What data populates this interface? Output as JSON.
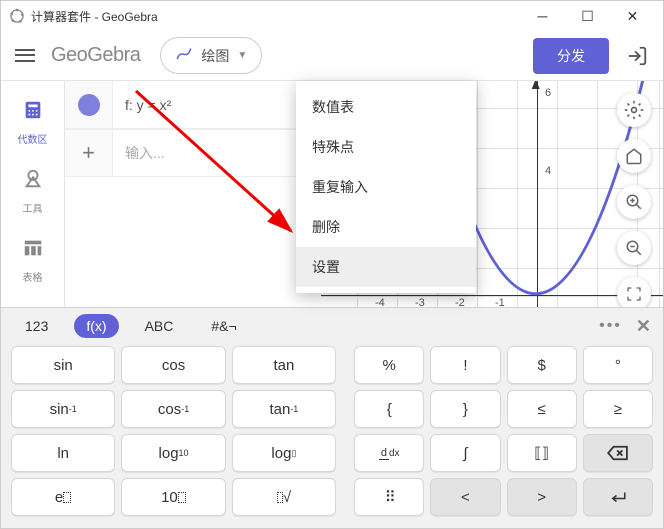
{
  "window": {
    "title": "计算器套件 - GeoGebra"
  },
  "header": {
    "logo": "GeoGebra",
    "mode": "绘图",
    "publish": "分发"
  },
  "sidebar": {
    "items": [
      {
        "label": "代数区"
      },
      {
        "label": "工具"
      },
      {
        "label": "表格"
      }
    ]
  },
  "algebra": {
    "rows": [
      {
        "expr": "f: y = x²"
      }
    ],
    "input_placeholder": "输入..."
  },
  "graph": {
    "y_ticks": [
      "6",
      "4"
    ],
    "x_ticks": [
      "-4",
      "-3",
      "-2",
      "-1"
    ]
  },
  "context_menu": {
    "items": [
      "数值表",
      "特殊点",
      "重复输入",
      "删除",
      "设置"
    ]
  },
  "kbd": {
    "tabs": [
      "123",
      "f(x)",
      "ABC",
      "#&¬"
    ],
    "rows": [
      [
        "sin",
        "cos",
        "tan",
        "%",
        "!",
        "$",
        "°"
      ],
      [
        "sin⁻¹",
        "cos⁻¹",
        "tan⁻¹",
        "{",
        "}",
        "≤",
        "≥"
      ],
      [
        "ln",
        "log₁₀",
        "log▯",
        "d/dx",
        "∫",
        "⟦⟧",
        "⌫"
      ],
      [
        "e▯",
        "10▯",
        "ⁿ√",
        "⠿",
        "<",
        ">",
        "↵"
      ]
    ]
  }
}
